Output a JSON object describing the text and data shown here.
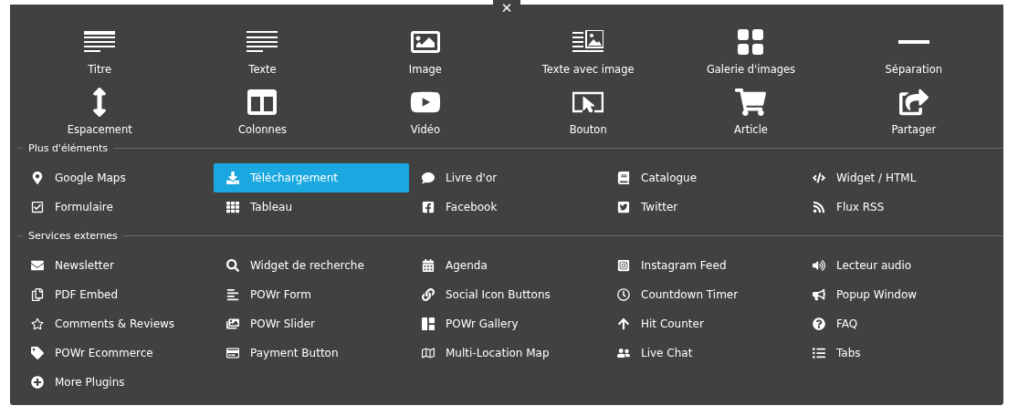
{
  "close_button": "✕",
  "elements": [
    {
      "label": "Titre",
      "selected": false
    },
    {
      "label": "Texte",
      "selected": false
    },
    {
      "label": "Image",
      "selected": false
    },
    {
      "label": "Texte avec image",
      "selected": false
    },
    {
      "label": "Galerie d'images",
      "selected": false
    },
    {
      "label": "Séparation",
      "selected": false
    },
    {
      "label": "Espacement",
      "selected": false
    },
    {
      "label": "Colonnes",
      "selected": false
    },
    {
      "label": "Vidéo",
      "selected": false
    },
    {
      "label": "Bouton",
      "selected": false
    },
    {
      "label": "Article",
      "selected": false
    },
    {
      "label": "Partager",
      "selected": false
    }
  ],
  "sections": [
    {
      "title": "Plus d'éléments",
      "items": [
        {
          "label": "Google Maps",
          "selected": false
        },
        {
          "label": "Téléchargement",
          "selected": true
        },
        {
          "label": "Livre d'or",
          "selected": false
        },
        {
          "label": "Catalogue",
          "selected": false
        },
        {
          "label": "Widget / HTML",
          "selected": false
        },
        {
          "label": "Formulaire",
          "selected": false
        },
        {
          "label": "Tableau",
          "selected": false
        },
        {
          "label": "Facebook",
          "selected": false
        },
        {
          "label": "Twitter",
          "selected": false
        },
        {
          "label": "Flux RSS",
          "selected": false
        }
      ]
    },
    {
      "title": "Services externes",
      "items": [
        {
          "label": "Newsletter",
          "selected": false
        },
        {
          "label": "Widget de recherche",
          "selected": false
        },
        {
          "label": "Agenda",
          "selected": false
        },
        {
          "label": "Instagram Feed",
          "selected": false
        },
        {
          "label": "Lecteur audio",
          "selected": false
        },
        {
          "label": "PDF Embed",
          "selected": false
        },
        {
          "label": "POWr Form",
          "selected": false
        },
        {
          "label": "Social Icon Buttons",
          "selected": false
        },
        {
          "label": "Countdown Timer",
          "selected": false
        },
        {
          "label": "Popup Window",
          "selected": false
        },
        {
          "label": "Comments & Reviews",
          "selected": false
        },
        {
          "label": "POWr Slider",
          "selected": false
        },
        {
          "label": "POWr Gallery",
          "selected": false
        },
        {
          "label": "Hit Counter",
          "selected": false
        },
        {
          "label": "FAQ",
          "selected": false
        },
        {
          "label": "POWr Ecommerce",
          "selected": false
        },
        {
          "label": "Payment Button",
          "selected": false
        },
        {
          "label": "Multi-Location Map",
          "selected": false
        },
        {
          "label": "Live Chat",
          "selected": false
        },
        {
          "label": "Tabs",
          "selected": false
        },
        {
          "label": "More Plugins",
          "selected": false
        }
      ]
    }
  ]
}
